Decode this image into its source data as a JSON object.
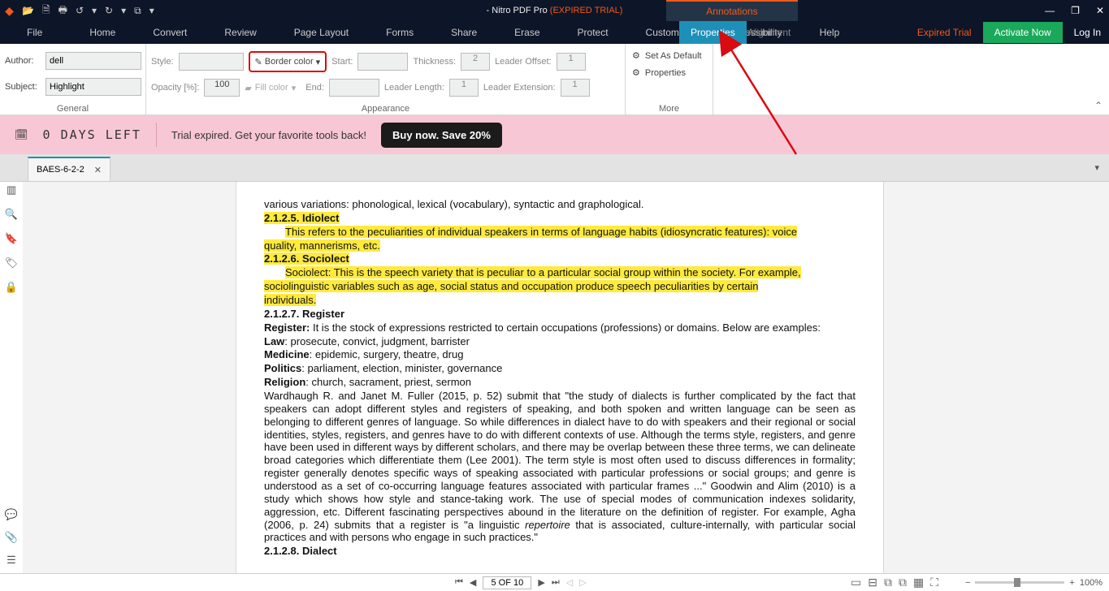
{
  "titlebar": {
    "title_prefix": "- Nitro PDF Pro ",
    "title_suffix": "(EXPIRED TRIAL)",
    "annotations_tab": "Annotations",
    "qat": {
      "open": "📂",
      "new": "🗎",
      "print": "🖶",
      "undo": "↺",
      "redo": "↻",
      "more": "▾",
      "tool": "⧉"
    }
  },
  "menus": {
    "file": "File",
    "home": "Home",
    "convert": "Convert",
    "review": "Review",
    "page_layout": "Page Layout",
    "forms": "Forms",
    "share": "Share",
    "erase": "Erase",
    "protect": "Protect",
    "customize": "Customize",
    "accessibility": "Accessibility",
    "help": "Help",
    "properties": "Properties",
    "alignment": "Alignment",
    "expired": "Expired Trial",
    "activate": "Activate Now",
    "login": "Log In"
  },
  "ribbon": {
    "general": {
      "label": "General",
      "author_label": "Author:",
      "author_value": "dell",
      "subject_label": "Subject:",
      "subject_value": "Highlight"
    },
    "appearance": {
      "label": "Appearance",
      "style": "Style:",
      "opacity": "Opacity [%]:",
      "opacity_val": "100",
      "border_color": "Border color",
      "fill_color": "Fill color",
      "start": "Start:",
      "end": "End:",
      "thickness": "Thickness:",
      "thickness_val": "2",
      "leader_length": "Leader Length:",
      "leader_length_val": "1",
      "leader_offset": "Leader Offset:",
      "leader_offset_val": "1",
      "leader_ext": "Leader Extension:",
      "leader_ext_val": "1"
    },
    "more": {
      "label": "More",
      "set_default": "Set As Default",
      "properties": "Properties"
    }
  },
  "banner": {
    "days": "0 DAYS LEFT",
    "msg": "Trial expired. Get your favorite tools back!",
    "buy": "Buy now. Save 20%"
  },
  "doctab": {
    "name": "BAES-6-2-2",
    "close": "✕"
  },
  "page_text": {
    "l0": "various variations: phonological, lexical (vocabulary), syntactic and graphological.",
    "h1": "2.1.2.5. Idiolect",
    "p1a": "This refers to the peculiarities of individual speakers in terms of language habits (idiosyncratic features): voice",
    "p1b": "quality, mannerisms, etc.",
    "h2": "2.1.2.6. Sociolect",
    "p2a": "Sociolect: This is the speech variety that is peculiar to a particular social group within the society. For example,",
    "p2b": "sociolinguistic variables such as age, social status and occupation produce speech peculiarities by certain",
    "p2c": "individuals.",
    "h3": "2.1.2.7. Register",
    "reg1": "Register:",
    "reg1b": " It is the stock of expressions restricted to certain occupations (professions) or domains. Below are examples:",
    "law": "Law",
    "law_b": ": prosecute, convict, judgment, barrister",
    "med": "Medicine",
    "med_b": ": epidemic, surgery, theatre, drug",
    "pol": "Politics",
    "pol_b": ": parliament, election, minister, governance",
    "rel": "Religion",
    "rel_b": ": church, sacrament, priest, sermon",
    "para1": "Wardhaugh R. and Janet M. Fuller (2015, p. 52) submit that \"the study of dialects is further complicated by the fact that speakers can adopt different styles and registers of speaking, and both spoken and written language can be seen as belonging to different genres of language. So while differences in dialect have to do with speakers and their regional or social identities, styles, registers, and genres have to do with different contexts of use. Although the terms style, registers, and genre have been used in different ways by different scholars, and there may be overlap between these three terms, we can delineate broad categories which differentiate them (Lee 2001). The term style is most often used to discuss differences in formality; register generally denotes specific ways of speaking associated with particular professions or social groups; and genre is understood as a set of co-occurring language features associated with particular frames ...\" Goodwin and Alim (2010) is a study which shows how style and stance-taking work. The use of special modes of communication indexes solidarity, aggression, etc. Different fascinating perspectives abound in the literature on the definition of register. For example, Agha (2006, p. 24) submits that a register is \"a linguistic ",
    "rep": "repertoire",
    "para1b": " that is associated, culture-internally, with particular social practices and with persons who engage in such practices.\"",
    "h4": "2.1.2.8. Dialect"
  },
  "status": {
    "page": "5 OF 10",
    "zoom": "100%"
  }
}
